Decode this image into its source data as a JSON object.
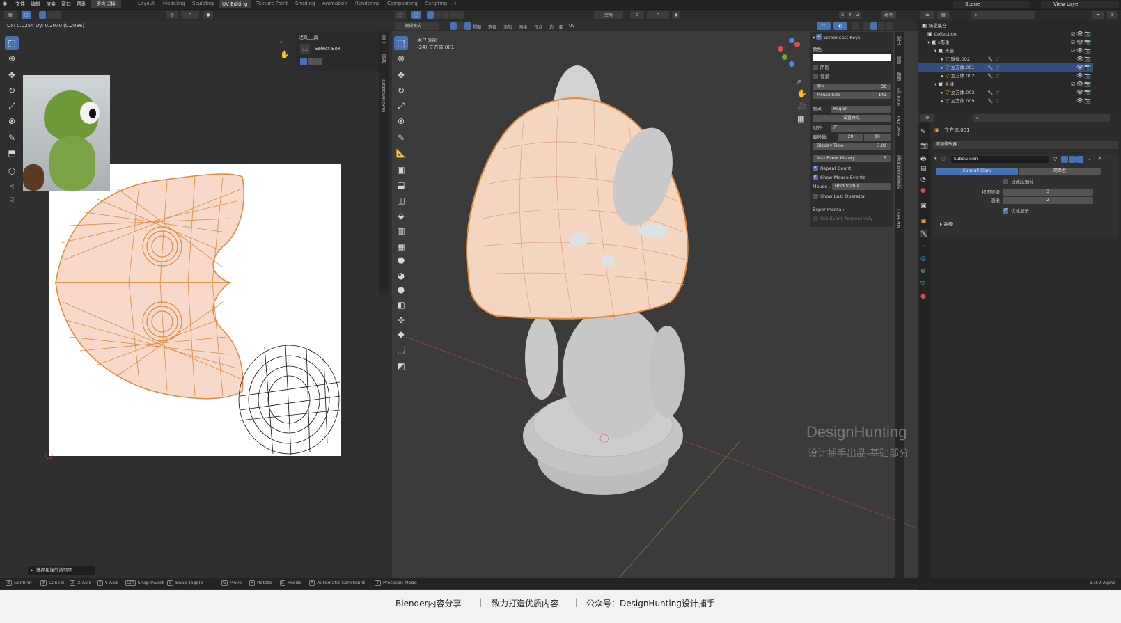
{
  "topbar": {
    "menus": [
      "文件",
      "编辑",
      "渲染",
      "窗口",
      "帮助"
    ],
    "switch_label": "语言切换",
    "workspaces": [
      "Layout",
      "Modeling",
      "Sculpting",
      "UV Editing",
      "Texture Paint",
      "Shading",
      "Animation",
      "Rendering",
      "Compositing",
      "Scripting"
    ],
    "active_workspace": "UV Editing",
    "add_tab": "+",
    "scene": "Scene",
    "view_layer": "View Layer"
  },
  "uv_editor": {
    "delta_text": "Dx: 0.0254  Dy: 0.2070 (0.2086)",
    "active_tool_title": "活动工具",
    "active_tool_name": "Select Box",
    "side_tabs": [
      "工具",
      "视图",
      "UVPackmaster2"
    ],
    "operator_panel": "选择相连的拾取项"
  },
  "viewport": {
    "mode_label": "编辑模式",
    "menu": [
      "视图",
      "选择",
      "添加",
      "网格",
      "顶点",
      "边",
      "面",
      "UV"
    ],
    "perspective": "用户透视",
    "object_label": "(24) 立方体.001",
    "transform_orient": "全局",
    "options_label": "选项",
    "axis_labels": [
      "X",
      "Y",
      "Z"
    ],
    "side_tabs": [
      "工具",
      "视图",
      "编辑",
      "HardOps",
      "BoxCutter",
      "Screencast Keys",
      "MACHIN3"
    ]
  },
  "screencast": {
    "title": "Screencast Keys",
    "color_label": "颜色:",
    "shadow": "阴影",
    "background": "背景",
    "font_label": "字号",
    "font_value": "30",
    "mouse_size_label": "Mouse Size",
    "mouse_size_value": "141",
    "origin_label": "原点:",
    "origin_value": "Region",
    "set_origin": "设置原点",
    "align_label": "对齐:",
    "align_value": "左",
    "offset_label": "偏移量:",
    "offset_x": "20",
    "offset_y": "80",
    "display_time_label": "Display Time",
    "display_time_value": "3.00",
    "max_history_label": "Max Event History",
    "max_history_value": "5",
    "repeat_count": "Repeat Count",
    "show_mouse_events": "Show Mouse Events",
    "mouse_label": "Mouse ..",
    "mouse_value": "Hold Status",
    "show_last_operator": "Show Last Operator",
    "experimental": "Experimental:",
    "get_event": "Get Event Aggressively"
  },
  "outliner": {
    "root": "场景集合",
    "items": [
      {
        "label": "Collection",
        "indent": 0
      },
      {
        "label": "x形象",
        "indent": 1
      },
      {
        "label": "头部",
        "indent": 2
      },
      {
        "label": "球体.002",
        "indent": 3
      },
      {
        "label": "立方体.001",
        "indent": 3,
        "selected": true
      },
      {
        "label": "立方体.002",
        "indent": 3
      },
      {
        "label": "身体",
        "indent": 2
      },
      {
        "label": "立方体.003",
        "indent": 3
      },
      {
        "label": "立方体.009",
        "indent": 3
      }
    ]
  },
  "properties": {
    "object_name": "立方体.001",
    "add_modifier": "添加修改器",
    "modifier_name": "Subdivision",
    "tab_catmull": "Catmull-Clark",
    "tab_simple": "简单型",
    "adaptive": "自适应细分",
    "viewport_levels_label": "视图层级",
    "viewport_levels_value": "3",
    "render_label": "渲染",
    "render_value": "2",
    "optimal_display": "优化显示",
    "advanced": "高级"
  },
  "watermark": {
    "line1": "DesignHunting",
    "line2": "设计捕手出品-基础部分"
  },
  "statusbar": {
    "items": [
      {
        "key": "⟲",
        "label": "Confirm"
      },
      {
        "key": "⟳",
        "label": "Cancel"
      },
      {
        "key": "X",
        "label": "X Axis"
      },
      {
        "key": "Y",
        "label": "Y Axis"
      },
      {
        "key": "Ctrl",
        "label": "Snap Invert"
      },
      {
        "key": "⇧",
        "label": "Snap Toggle"
      },
      {
        "key": "G",
        "label": "Move"
      },
      {
        "key": "R",
        "label": "Rotate"
      },
      {
        "key": "S",
        "label": "Resize"
      },
      {
        "key": "A",
        "label": "Automatic Constraint"
      },
      {
        "key": "⇧",
        "label": "Precision Mode"
      }
    ],
    "version": "3.0.0 Alpha"
  },
  "caption": {
    "text1": "Blender内容分享",
    "sep": "|",
    "text2": "致力打造优质内容",
    "text3": "公众号：DesignHunting设计捕手"
  },
  "colors": {
    "accent": "#4772b3",
    "uv_face": "#f6d3c3",
    "uv_edge": "#e08a3c",
    "mesh_orange": "#f3c4a4",
    "body_grey": "#c7c7c7"
  }
}
